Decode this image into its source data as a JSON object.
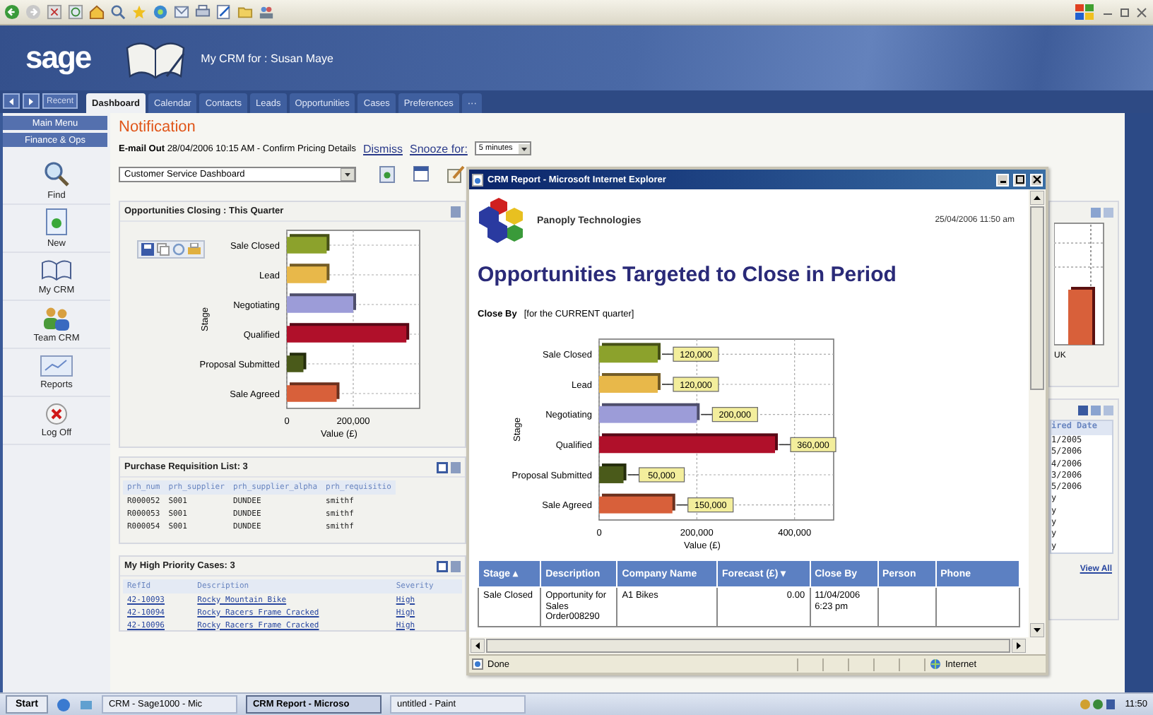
{
  "header": {
    "logo": "sage",
    "title": "My CRM for : Susan Maye"
  },
  "nav": {
    "recent": "Recent"
  },
  "tabs": [
    {
      "label": "Dashboard",
      "selected": true
    },
    {
      "label": "Calendar",
      "selected": false
    },
    {
      "label": "Contacts",
      "selected": false
    },
    {
      "label": "Leads",
      "selected": false
    },
    {
      "label": "Opportunities",
      "selected": false
    },
    {
      "label": "Cases",
      "selected": false
    },
    {
      "label": "Preferences",
      "selected": false
    },
    {
      "label": "···",
      "selected": false
    }
  ],
  "sidebar": {
    "menus": [
      {
        "label": "Main Menu"
      },
      {
        "label": "Finance & Ops"
      }
    ],
    "items": [
      {
        "label": "Find",
        "kind": "find"
      },
      {
        "label": "New",
        "kind": "new"
      },
      {
        "label": "My CRM",
        "kind": "mycrm"
      },
      {
        "label": "Team CRM",
        "kind": "team"
      },
      {
        "label": "Reports",
        "kind": "reports"
      },
      {
        "label": "Log Off",
        "kind": "logoff"
      }
    ]
  },
  "notification": {
    "title": "Notification",
    "message": "**E-mail Out** 28/04/2006 10:15 AM - Confirm Pricing Details",
    "dismiss": "Dismiss",
    "snooze": "Snooze for:",
    "snooze_value": "5 minutes"
  },
  "dashboard_select": {
    "value": "Customer Service Dashboard"
  },
  "opportunities_panel": {
    "title": "Opportunities Closing : This Quarter",
    "chart_data": {
      "type": "bar",
      "orientation": "horizontal",
      "xlabel": "Value (£)",
      "ylabel": "Stage",
      "categories": [
        "Sale Closed",
        "Lead",
        "Negotiating",
        "Qualified",
        "Proposal Submitted",
        "Sale Agreed"
      ],
      "values": [
        120000,
        120000,
        200000,
        360000,
        50000,
        150000
      ],
      "colors": [
        "#8ca22c",
        "#e8b84a",
        "#9c9cd8",
        "#b0102a",
        "#4a5a1a",
        "#d8603a"
      ],
      "xlim": [
        0,
        400000
      ],
      "xticks": [
        0,
        {
          "value": 200000,
          "label": "200,000"
        }
      ],
      "grid": true
    }
  },
  "requisition_panel": {
    "title": "Purchase Requisition List: 3",
    "columns": [
      "prh_num",
      "prh_supplier",
      "prh_supplier_alpha",
      "prh_requisitio"
    ],
    "rows": [
      [
        "R000052",
        "S001",
        "DUNDEE",
        "smithf"
      ],
      [
        "R000053",
        "S001",
        "DUNDEE",
        "smithf"
      ],
      [
        "R000054",
        "S001",
        "DUNDEE",
        "smithf"
      ]
    ]
  },
  "cases_panel": {
    "title": "My High Priority Cases: 3",
    "columns": [
      "RefId",
      "Description",
      "Severity"
    ],
    "rows": [
      [
        "42-10093",
        "Rocky Mountain Bike",
        "High"
      ],
      [
        "42-10094",
        "Rocky Racers Frame Cracked",
        "High"
      ],
      [
        "42-10096",
        "Rocky Racers Frame Cracked",
        "High"
      ]
    ]
  },
  "right_panels": {
    "chart_label": "UK",
    "list_header": "ired Date",
    "list_rows": [
      "1/2005",
      "5/2006",
      "4/2006",
      "3/2006",
      "5/2006",
      "y",
      "y",
      "y",
      "y",
      "y"
    ],
    "view_all": "View All"
  },
  "report_window": {
    "title": "CRM Report - Microsoft Internet Explorer",
    "company": "Panoply Technologies",
    "date": "25/04/2006 11:50 am",
    "heading": "Opportunities Targeted to Close in Period",
    "filter_label": "Close By",
    "filter_text": "[for the CURRENT quarter]",
    "chart_data": {
      "type": "bar",
      "orientation": "horizontal",
      "xlabel": "Value (£)",
      "ylabel": "Stage",
      "categories": [
        "Sale Closed",
        "Lead",
        "Negotiating",
        "Qualified",
        "Proposal Submitted",
        "Sale Agreed"
      ],
      "values": [
        120000,
        120000,
        200000,
        360000,
        50000,
        150000
      ],
      "colors": [
        "#8ca22c",
        "#e8b84a",
        "#9c9cd8",
        "#b0102a",
        "#4a5a1a",
        "#d8603a"
      ],
      "xlim": [
        0,
        480000
      ],
      "xticks": [
        0,
        {
          "value": 200000,
          "label": "200,000"
        },
        {
          "value": 400000,
          "label": "400,000"
        }
      ],
      "value_labels": [
        "120,000",
        "120,000",
        "200,000",
        "360,000",
        "50,000",
        "150,000"
      ],
      "grid": true
    },
    "table": {
      "columns": [
        "Stage ▴",
        "Description",
        "Company Name",
        "Forecast (£) ▾",
        "Close By",
        "Person",
        "Phone"
      ],
      "rows": [
        [
          "Sale Closed",
          "Opportunity for Sales Order008290",
          "A1 Bikes",
          "0.00",
          "11/04/2006 6:23 pm",
          "",
          ""
        ]
      ]
    },
    "status": "Done",
    "zone": "Internet"
  },
  "taskbar": {
    "start": "Start",
    "items": [
      {
        "label": "CRM - Sage1000 - Mic",
        "selected": false
      },
      {
        "label": "CRM Report - Microso",
        "selected": true
      },
      {
        "label": "untitled - Paint",
        "selected": false
      }
    ],
    "clock": "11:50"
  }
}
